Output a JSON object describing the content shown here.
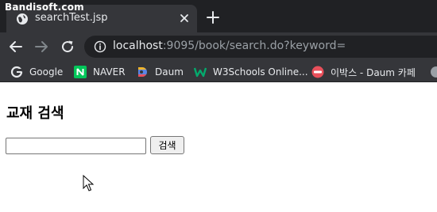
{
  "watermark": "Bandisoft.com",
  "tab": {
    "title": "searchTest.jsp",
    "icon": "globe-icon"
  },
  "toolbar": {
    "url_host": "localhost",
    "url_rest": ":9095/book/search.do?keyword="
  },
  "bookmarks": [
    {
      "label": "Google",
      "icon": "google-icon"
    },
    {
      "label": "NAVER",
      "icon": "naver-icon"
    },
    {
      "label": "Daum",
      "icon": "daum-icon"
    },
    {
      "label": "W3Schools Online...",
      "icon": "w3schools-icon"
    },
    {
      "label": "이박스 - Daum 카페",
      "icon": "daum-cafe-icon"
    }
  ],
  "page": {
    "title": "교재 검색",
    "search_value": "",
    "search_button": "검색"
  },
  "colors": {
    "tabstrip": "#202124",
    "toolbar": "#35363a",
    "text_light": "#e8eaed",
    "text_dim": "#9aa0a6"
  }
}
